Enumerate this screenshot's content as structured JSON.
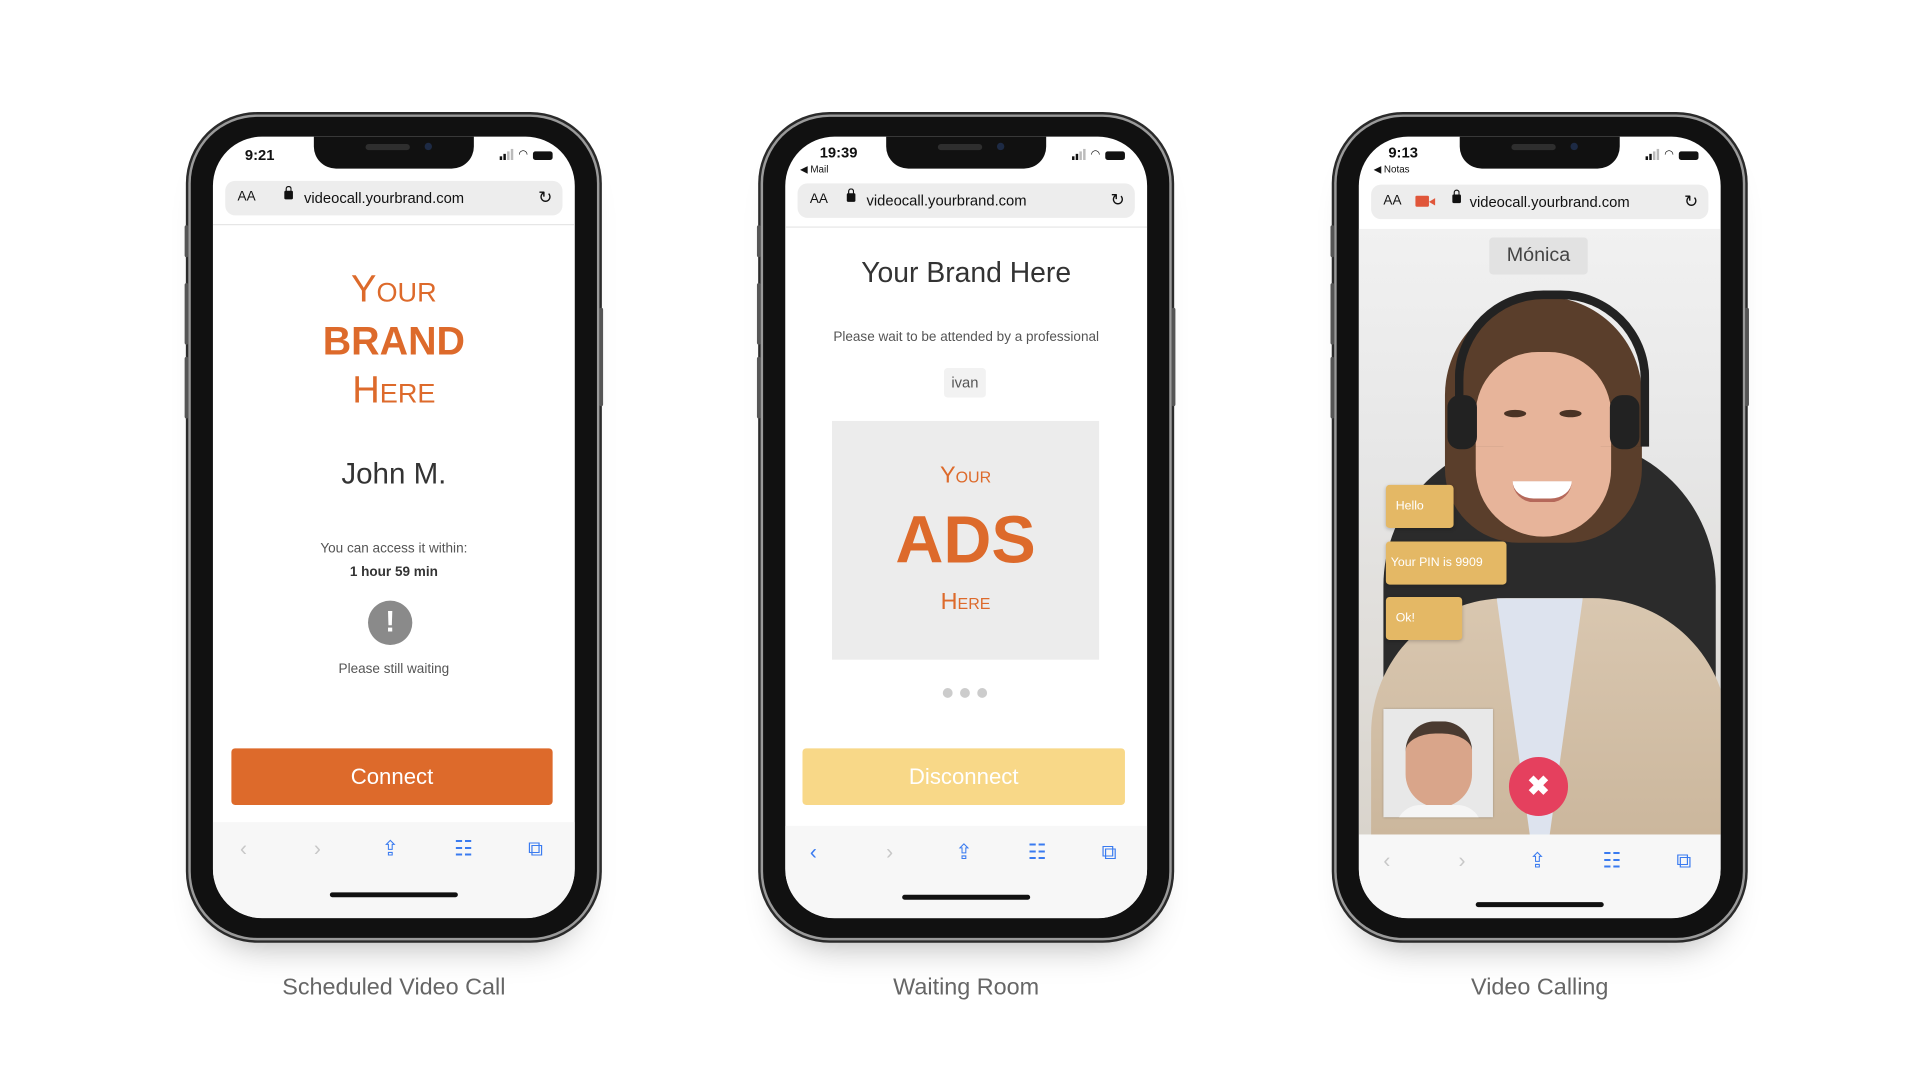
{
  "url": "videocall.yourbrand.com",
  "text_size_label": "AA",
  "phones": [
    {
      "caption": "Scheduled Video Call",
      "time": "9:21",
      "brand": {
        "line1": "Your",
        "line2": "BRAND",
        "line3": "Here"
      },
      "user_name": "John M.",
      "access_label": "You can access it within:",
      "access_time": "1 hour 59 min",
      "status_icon": "exclamation-icon",
      "status_text": "Please still waiting",
      "button_label": "Connect",
      "button_color": "#dd6a2b"
    },
    {
      "caption": "Waiting Room",
      "time": "19:39",
      "back_label": "◀ Mail",
      "title": "Your Brand Here",
      "wait_text": "Please wait to be attended by a professional",
      "professional": "ivan",
      "ads": {
        "line1": "Your",
        "line2": "ADS",
        "line3": "Here"
      },
      "button_label": "Disconnect",
      "button_color": "#f8d888"
    },
    {
      "caption": "Video Calling",
      "time": "9:13",
      "back_label": "◀ Notas",
      "remote_name": "Mónica",
      "messages": [
        "Hello",
        "Your PIN is 9909",
        "Ok!"
      ],
      "end_call_color": "#e5405e"
    }
  ]
}
